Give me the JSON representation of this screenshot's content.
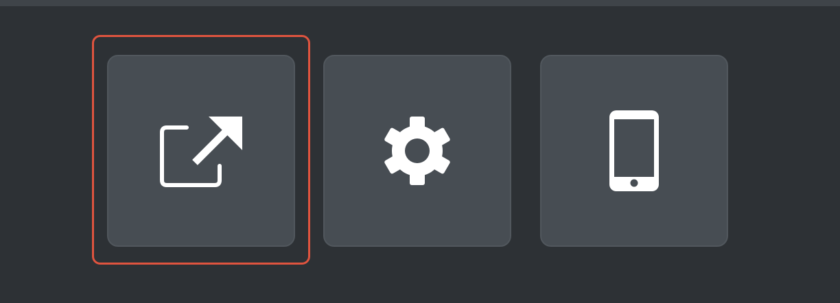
{
  "toolbar": {
    "buttons": [
      {
        "name": "open-in-new-window",
        "icon": "external-link-icon",
        "focused": true
      },
      {
        "name": "settings",
        "icon": "gear-icon",
        "focused": false
      },
      {
        "name": "device-preview",
        "icon": "smartphone-icon",
        "focused": false
      }
    ]
  },
  "colors": {
    "background": "#2d3135",
    "top_strip": "#3f4449",
    "button_fill": "#474d53",
    "button_border": "#51575d",
    "icon": "#ffffff",
    "focus_ring": "#e0543f"
  }
}
